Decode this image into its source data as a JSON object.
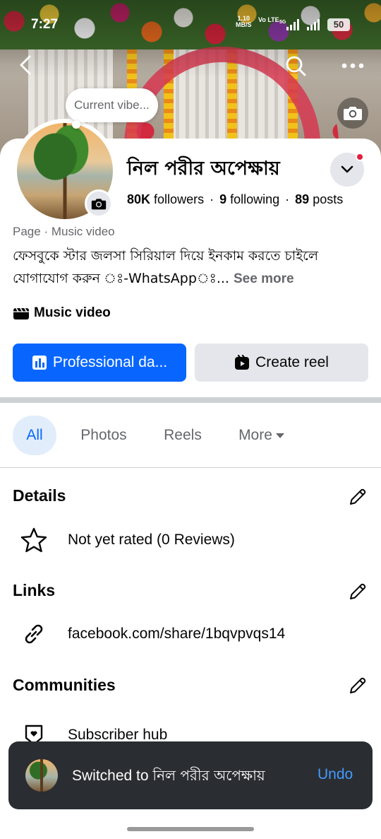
{
  "status_bar": {
    "time": "7:27",
    "network_speed": "1.10",
    "network_unit": "MB/S",
    "volte": "Vo LTE",
    "signal_label": "5G",
    "battery": "50"
  },
  "cover": {
    "vibe_placeholder": "Current vibe..."
  },
  "profile": {
    "name": "নিল পরীর অপেক্ষায়",
    "followers_count": "80K",
    "followers_label": "followers",
    "following_count": "9",
    "following_label": "following",
    "posts_count": "89",
    "posts_label": "posts",
    "separator": "·",
    "page_type": "Page",
    "category_meta": "Music video",
    "bio": "ফেসবুকে স্টার জলসা সিরিয়াল দিয়ে ইনকাম করতে চাইলে যোগাযোগ করুন ঃ-WhatsAppঃ...",
    "see_more": "See more",
    "category_badge": "Music video"
  },
  "actions": {
    "professional": "Professional da...",
    "create_reel": "Create reel"
  },
  "tabs": [
    {
      "label": "All"
    },
    {
      "label": "Photos"
    },
    {
      "label": "Reels"
    },
    {
      "label": "More"
    }
  ],
  "details": {
    "title": "Details",
    "rating": "Not yet rated (0 Reviews)"
  },
  "links": {
    "title": "Links",
    "url": "facebook.com/share/1bqvpvqs14"
  },
  "communities": {
    "title": "Communities",
    "subscriber_hub": "Subscriber hub"
  },
  "toast": {
    "prefix": "Switched to",
    "name": "নিল পরীর অপেক্ষায়",
    "undo": "Undo"
  },
  "colors": {
    "brand_blue": "#0866ff",
    "tab_active_bg": "#e2edfb",
    "toast_bg": "#2a2d31",
    "undo_blue": "#4599ff",
    "notification_red": "#e41e3f"
  }
}
